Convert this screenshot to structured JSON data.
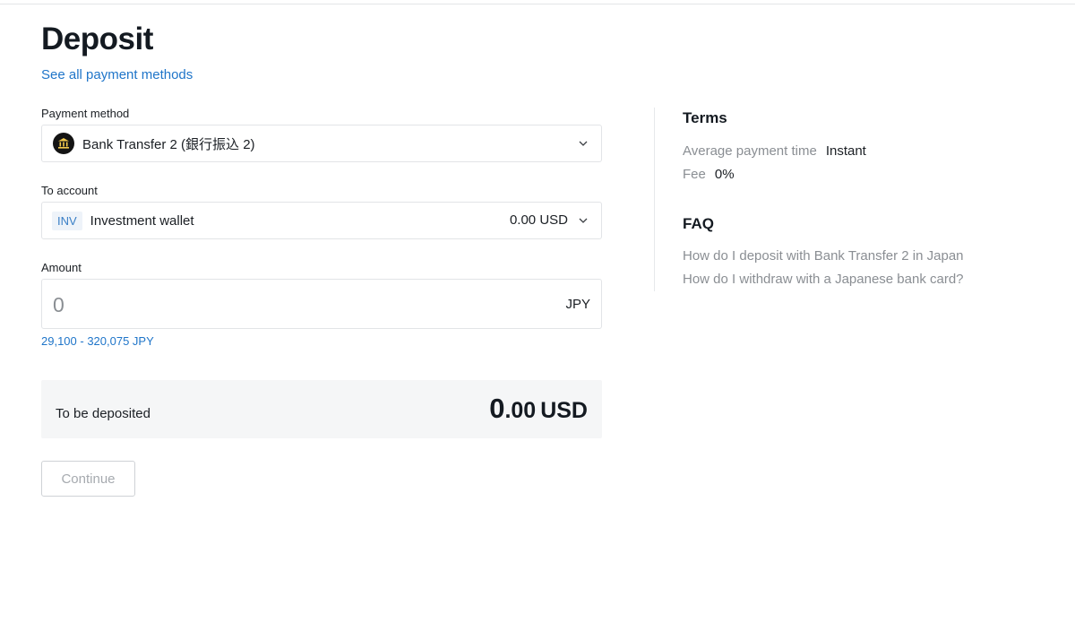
{
  "page": {
    "title": "Deposit",
    "see_all_link": "See all payment methods"
  },
  "payment_method": {
    "label": "Payment method",
    "icon": "bank-icon",
    "selected": "Bank Transfer 2 (銀行振込 2)"
  },
  "to_account": {
    "label": "To account",
    "badge": "INV",
    "name": "Investment wallet",
    "balance": "0.00 USD"
  },
  "amount": {
    "label": "Amount",
    "placeholder": "0",
    "currency": "JPY",
    "range": "29,100 - 320,075 JPY"
  },
  "summary": {
    "label": "To be deposited",
    "integer": "0",
    "decimals": ".00",
    "currency": "USD"
  },
  "actions": {
    "continue_label": "Continue"
  },
  "terms": {
    "title": "Terms",
    "rows": [
      {
        "key": "Average payment time",
        "value": "Instant"
      },
      {
        "key": "Fee",
        "value": "0%"
      }
    ]
  },
  "faq": {
    "title": "FAQ",
    "items": [
      "How do I deposit with Bank Transfer 2 in Japan",
      "How do I withdraw with a Japanese bank card?"
    ]
  },
  "colors": {
    "link": "#1f75c9",
    "muted": "#8a8e93",
    "summary_bg": "#f5f6f7",
    "bank_icon_bg": "#141414",
    "bank_icon_fg": "#f2c94c"
  }
}
